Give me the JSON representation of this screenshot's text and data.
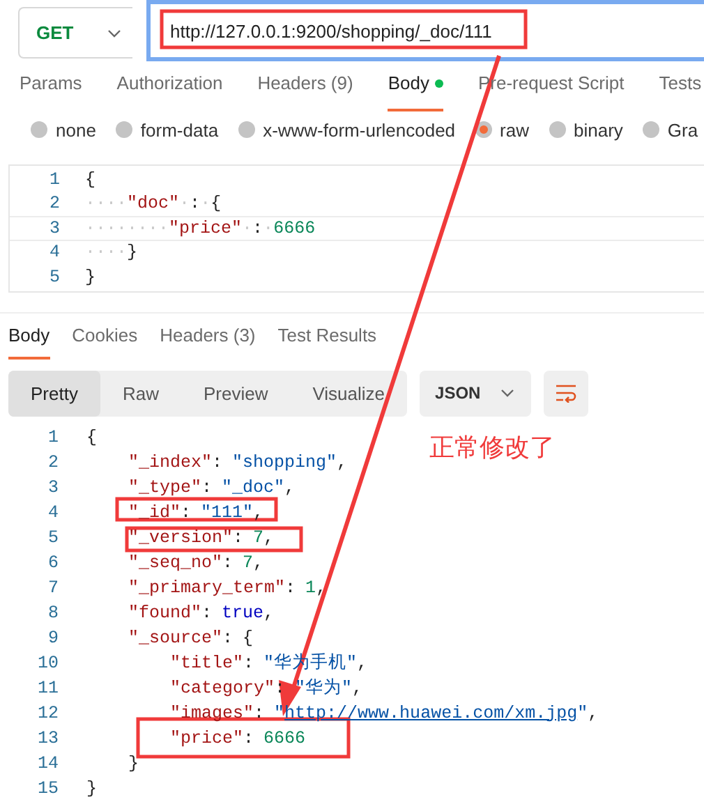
{
  "request": {
    "method": "GET",
    "url": "http://127.0.0.1:9200/shopping/_doc/111"
  },
  "request_tabs": [
    {
      "label": "Params",
      "selected": false,
      "modified": false
    },
    {
      "label": "Authorization",
      "selected": false,
      "modified": false
    },
    {
      "label": "Headers (9)",
      "selected": false,
      "modified": false
    },
    {
      "label": "Body",
      "selected": true,
      "modified": true
    },
    {
      "label": "Pre-request Script",
      "selected": false,
      "modified": false
    },
    {
      "label": "Tests",
      "selected": false,
      "modified": false
    }
  ],
  "body_types": [
    {
      "label": "none",
      "selected": false
    },
    {
      "label": "form-data",
      "selected": false
    },
    {
      "label": "x-www-form-urlencoded",
      "selected": false
    },
    {
      "label": "raw",
      "selected": true
    },
    {
      "label": "binary",
      "selected": false
    },
    {
      "label": "Gra",
      "selected": false
    }
  ],
  "request_body": {
    "lines": [
      {
        "number": "1",
        "active": false,
        "tokens": [
          {
            "kind": "punct",
            "text": "{"
          }
        ]
      },
      {
        "number": "2",
        "active": false,
        "tokens": [
          {
            "kind": "ws",
            "text": "····"
          },
          {
            "kind": "key",
            "text": "\"doc\""
          },
          {
            "kind": "ws",
            "text": "·"
          },
          {
            "kind": "punct",
            "text": ":"
          },
          {
            "kind": "ws",
            "text": "·"
          },
          {
            "kind": "punct",
            "text": "{"
          }
        ]
      },
      {
        "number": "3",
        "active": true,
        "tokens": [
          {
            "kind": "ws",
            "text": "········"
          },
          {
            "kind": "key",
            "text": "\"price\""
          },
          {
            "kind": "ws",
            "text": "·"
          },
          {
            "kind": "punct",
            "text": ":"
          },
          {
            "kind": "ws",
            "text": "·"
          },
          {
            "kind": "num",
            "text": "6666"
          }
        ]
      },
      {
        "number": "4",
        "active": false,
        "tokens": [
          {
            "kind": "ws",
            "text": "····"
          },
          {
            "kind": "punct",
            "text": "}"
          }
        ]
      },
      {
        "number": "5",
        "active": false,
        "tokens": [
          {
            "kind": "punct",
            "text": "}"
          }
        ]
      }
    ]
  },
  "response_tabs": [
    {
      "label": "Body",
      "selected": true
    },
    {
      "label": "Cookies",
      "selected": false
    },
    {
      "label": "Headers (3)",
      "selected": false
    },
    {
      "label": "Test Results",
      "selected": false
    }
  ],
  "view_modes": [
    {
      "label": "Pretty",
      "selected": true
    },
    {
      "label": "Raw",
      "selected": false
    },
    {
      "label": "Preview",
      "selected": false
    },
    {
      "label": "Visualize",
      "selected": false
    }
  ],
  "format": "JSON",
  "response_body": {
    "lines": [
      {
        "number": "1",
        "tokens": [
          {
            "kind": "punct",
            "text": "{"
          }
        ],
        "children": [
          {
            "number": "2",
            "tokens": [
              {
                "kind": "key",
                "text": "\"_index\""
              },
              {
                "kind": "punct",
                "text": ":"
              },
              {
                "kind": "str",
                "text": "\"shopping\""
              },
              {
                "kind": "punct",
                "text": ","
              }
            ]
          },
          {
            "number": "3",
            "tokens": [
              {
                "kind": "key",
                "text": "\"_type\""
              },
              {
                "kind": "punct",
                "text": ":"
              },
              {
                "kind": "str",
                "text": "\"_doc\""
              },
              {
                "kind": "punct",
                "text": ","
              }
            ]
          },
          {
            "number": "4",
            "tokens": [
              {
                "kind": "key",
                "text": "\"_id\""
              },
              {
                "kind": "punct",
                "text": ":"
              },
              {
                "kind": "str",
                "text": "\"111\""
              },
              {
                "kind": "punct",
                "text": ","
              }
            ]
          },
          {
            "number": "5",
            "tokens": [
              {
                "kind": "key",
                "text": "\"_version\""
              },
              {
                "kind": "punct",
                "text": ":"
              },
              {
                "kind": "num",
                "text": "7"
              },
              {
                "kind": "punct",
                "text": ","
              }
            ]
          },
          {
            "number": "6",
            "tokens": [
              {
                "kind": "key",
                "text": "\"_seq_no\""
              },
              {
                "kind": "punct",
                "text": ":"
              },
              {
                "kind": "num",
                "text": "7"
              },
              {
                "kind": "punct",
                "text": ","
              }
            ]
          },
          {
            "number": "7",
            "tokens": [
              {
                "kind": "key",
                "text": "\"_primary_term\""
              },
              {
                "kind": "punct",
                "text": ":"
              },
              {
                "kind": "num",
                "text": "1"
              },
              {
                "kind": "punct",
                "text": ","
              }
            ]
          },
          {
            "number": "8",
            "tokens": [
              {
                "kind": "key",
                "text": "\"found\""
              },
              {
                "kind": "punct",
                "text": ":"
              },
              {
                "kind": "bool",
                "text": "true"
              },
              {
                "kind": "punct",
                "text": ","
              }
            ]
          },
          {
            "number": "9",
            "tokens": [
              {
                "kind": "key",
                "text": "\"_source\""
              },
              {
                "kind": "punct",
                "text": ":"
              },
              {
                "kind": "punct",
                "text": "{"
              }
            ],
            "children": [
              {
                "number": "10",
                "tokens": [
                  {
                    "kind": "key",
                    "text": "\"title\""
                  },
                  {
                    "kind": "punct",
                    "text": ":"
                  },
                  {
                    "kind": "str",
                    "text": "\"华为手机\""
                  },
                  {
                    "kind": "punct",
                    "text": ","
                  }
                ]
              },
              {
                "number": "11",
                "tokens": [
                  {
                    "kind": "key",
                    "text": "\"category\""
                  },
                  {
                    "kind": "punct",
                    "text": ":"
                  },
                  {
                    "kind": "str",
                    "text": "\"华为\""
                  },
                  {
                    "kind": "punct",
                    "text": ","
                  }
                ]
              },
              {
                "number": "12",
                "tokens": [
                  {
                    "kind": "key",
                    "text": "\"images\""
                  },
                  {
                    "kind": "punct",
                    "text": ":"
                  },
                  {
                    "kind": "str",
                    "text": "\""
                  },
                  {
                    "kind": "link",
                    "text": "http://www.huawei.com/xm.jpg"
                  },
                  {
                    "kind": "str",
                    "text": "\""
                  },
                  {
                    "kind": "punct",
                    "text": ","
                  }
                ]
              },
              {
                "number": "13",
                "tokens": [
                  {
                    "kind": "key",
                    "text": "\"price\""
                  },
                  {
                    "kind": "punct",
                    "text": ":"
                  },
                  {
                    "kind": "num",
                    "text": "6666"
                  }
                ]
              }
            ]
          },
          {
            "number": "14",
            "tokens": [
              {
                "kind": "punct",
                "text": "}"
              }
            ]
          }
        ]
      },
      {
        "number": "15",
        "tokens": [
          {
            "kind": "punct",
            "text": "}"
          }
        ]
      }
    ]
  },
  "annotation": {
    "note": "正常修改了"
  }
}
